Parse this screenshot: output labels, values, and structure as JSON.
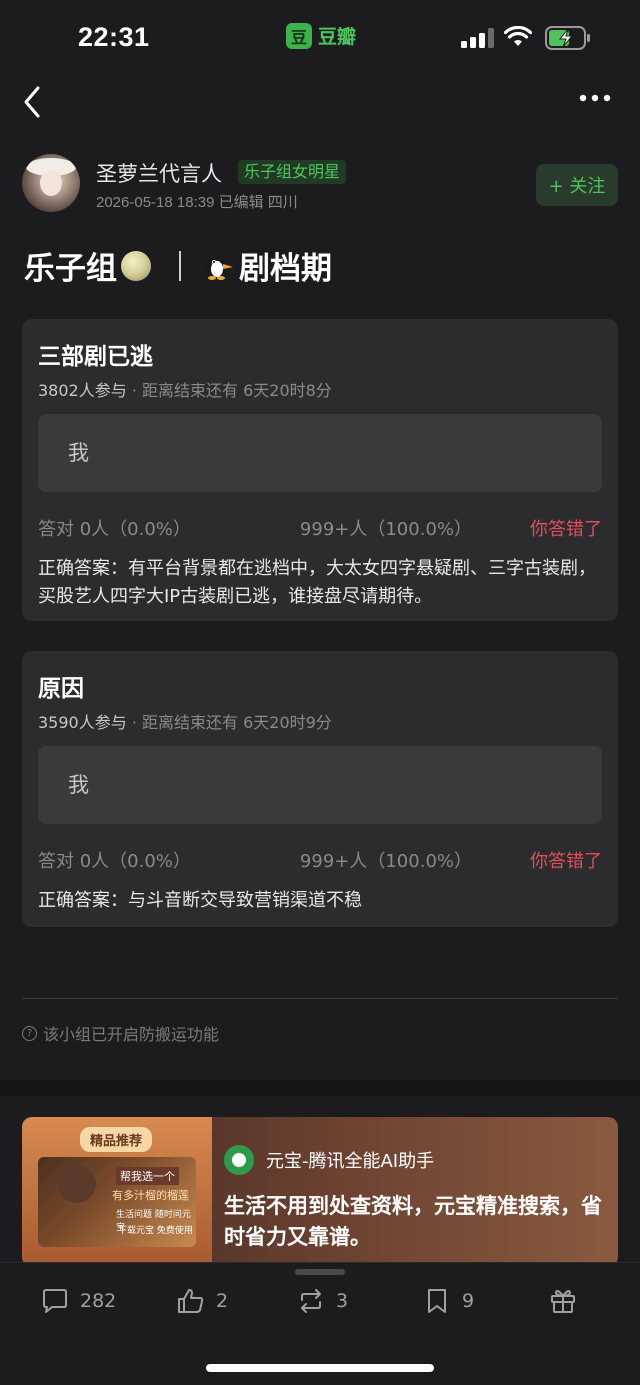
{
  "status_bar": {
    "time": "22:31",
    "app_badge_logo": "豆",
    "app_badge_name": "豆瓣"
  },
  "author": {
    "name": "圣萝兰代言人",
    "tag": "乐子组女明星",
    "meta": "2026-05-18 18:39  已编辑  四川",
    "follow_label": "+ 关注"
  },
  "post": {
    "title_part1": "乐子组",
    "title_part2": "剧档期"
  },
  "quizzes": [
    {
      "question": "三部剧已逃",
      "participants": "3802人参与",
      "countdown": "· 距离结束还有 6天20时8分",
      "my_answer": "我",
      "correct_count": "答对  0人（0.0%）",
      "total_count": "999+人（100.0%）",
      "verdict": "你答错了",
      "correct_answer": "正确答案：有平台背景都在逃档中，大太女四字悬疑剧、三字古装剧，买股艺人四字大IP古装剧已逃，谁接盘尽请期待。"
    },
    {
      "question": "原因",
      "participants": "3590人参与",
      "countdown": "· 距离结束还有 6天20时9分",
      "my_answer": "我",
      "correct_count": "答对  0人（0.0%）",
      "total_count": "999+人（100.0%）",
      "verdict": "你答错了",
      "correct_answer": "正确答案：与斗音断交导致营销渠道不稳"
    }
  ],
  "notice": "该小组已开启防搬运功能",
  "ad": {
    "tag": "精品推荐",
    "pic_line1": "帮我选一个",
    "pic_line2": "有多汁榴的榴莲",
    "pic_line3": "生活问题 随时问元宝",
    "pic_line4": "下载元宝  免费使用",
    "brand": "元宝-腾讯全能AI助手",
    "text": "生活不用到处查资料，元宝精准搜索，省时省力又靠谱。"
  },
  "tabbar": {
    "comments": "282",
    "likes": "2",
    "reposts": "3",
    "bookmarks": "9"
  },
  "colors": {
    "background": "#1c1c1e",
    "card": "#2c2c2e",
    "accent_green": "#4fc35b",
    "error_red": "#e0505a"
  }
}
